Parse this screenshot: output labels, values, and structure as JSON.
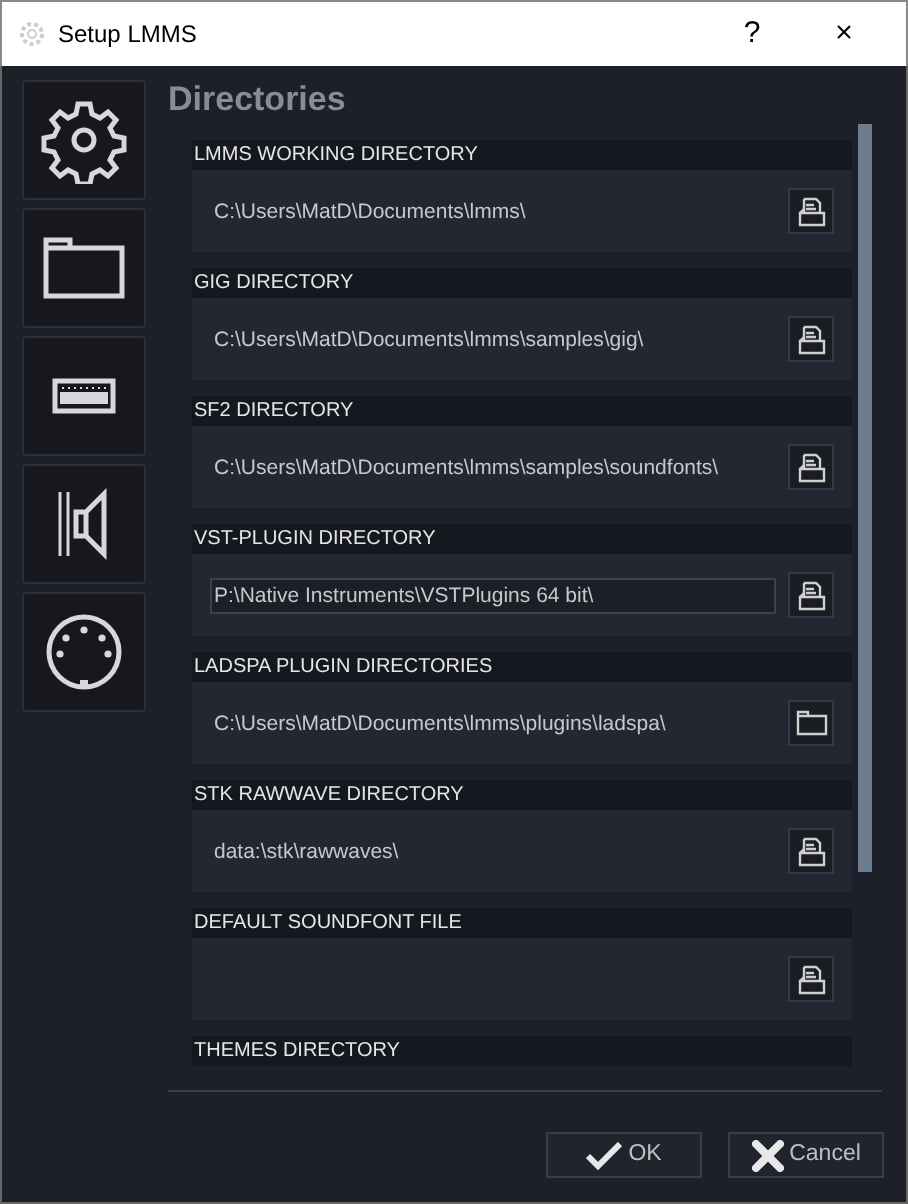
{
  "window": {
    "title": "Setup LMMS",
    "help": "?",
    "close": "×"
  },
  "sidebar": {
    "items": [
      {
        "kind": "settings"
      },
      {
        "kind": "folder"
      },
      {
        "kind": "keyboard"
      },
      {
        "kind": "speaker"
      },
      {
        "kind": "midi"
      }
    ]
  },
  "page_title": "Directories",
  "directories": [
    {
      "kind": "file",
      "label": "LMMS WORKING DIRECTORY",
      "value": "C:\\Users\\MatD\\Documents\\lmms\\",
      "focused": false
    },
    {
      "kind": "file",
      "label": "GIG DIRECTORY",
      "value": "C:\\Users\\MatD\\Documents\\lmms\\samples\\gig\\",
      "focused": false
    },
    {
      "kind": "file",
      "label": "SF2 DIRECTORY",
      "value": "C:\\Users\\MatD\\Documents\\lmms\\samples\\soundfonts\\",
      "focused": false
    },
    {
      "kind": "file",
      "label": "VST-PLUGIN DIRECTORY",
      "value": "P:\\Native Instruments\\VSTPlugins 64 bit\\",
      "focused": true
    },
    {
      "kind": "folder",
      "label": "LADSPA PLUGIN DIRECTORIES",
      "value": "C:\\Users\\MatD\\Documents\\lmms\\plugins\\ladspa\\",
      "focused": false
    },
    {
      "kind": "file",
      "label": "STK RAWWAVE DIRECTORY",
      "value": "data:\\stk\\rawwaves\\",
      "focused": false
    },
    {
      "kind": "file",
      "label": "DEFAULT SOUNDFONT FILE"
    },
    {
      "kind": "header",
      "label": "THEMES DIRECTORY"
    }
  ],
  "buttons": [
    {
      "kind": "ok",
      "label": "OK"
    },
    {
      "kind": "cancel",
      "label": "Cancel"
    }
  ]
}
